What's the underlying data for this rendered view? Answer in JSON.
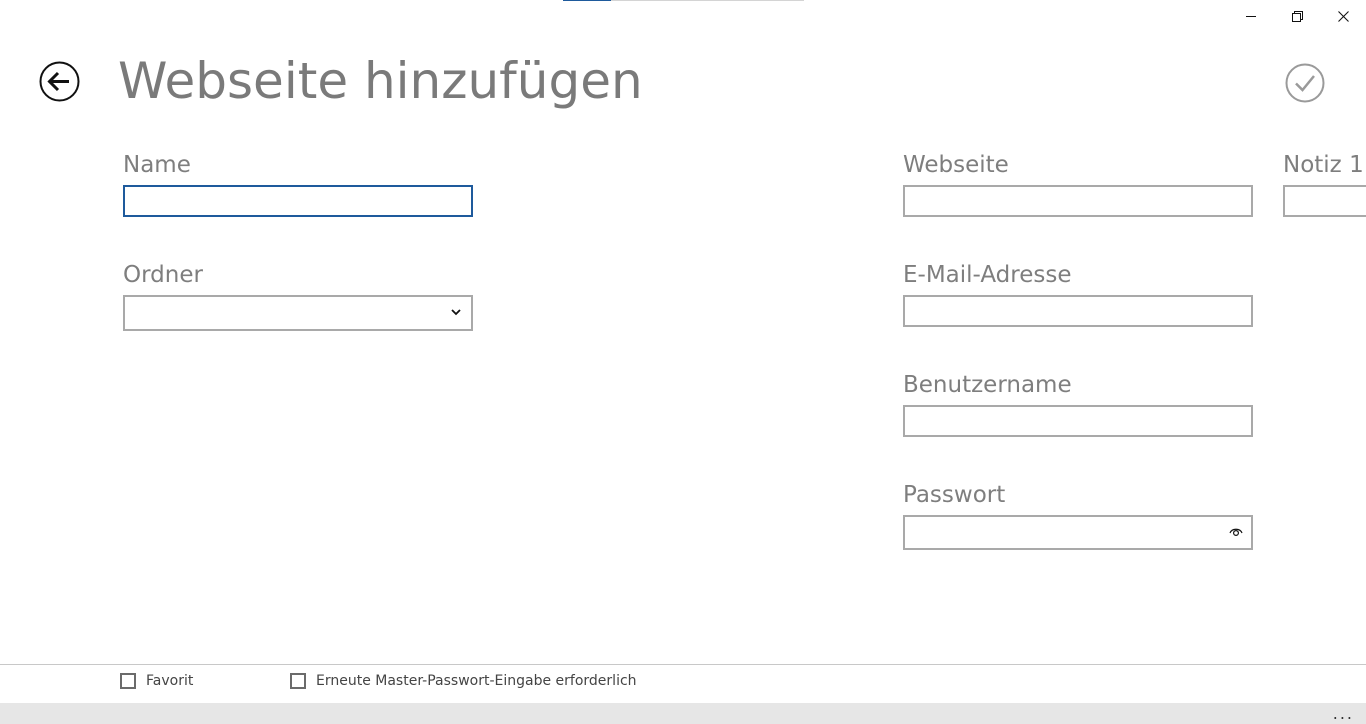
{
  "progress": {
    "fraction": 0.2,
    "color": "#1e5a9c"
  },
  "window_controls": {
    "minimize_icon": "minimize-icon",
    "restore_icon": "restore-icon",
    "close_icon": "close-icon"
  },
  "header": {
    "title": "Webseite hinzufügen",
    "back_icon": "arrow-left-circle-icon",
    "save_icon": "check-circle-icon"
  },
  "form": {
    "name": {
      "label": "Name",
      "value": "",
      "focused": true
    },
    "folder": {
      "label": "Ordner",
      "value": ""
    },
    "website": {
      "label": "Webseite",
      "value": ""
    },
    "email": {
      "label": "E-Mail-Adresse",
      "value": ""
    },
    "username": {
      "label": "Benutzername",
      "value": ""
    },
    "password": {
      "label": "Passwort",
      "value": "",
      "reveal_icon": "eye-icon"
    },
    "note": {
      "label": "Notiz 1",
      "value": ""
    }
  },
  "options": {
    "favorite": {
      "label": "Favorit",
      "checked": false
    },
    "reprompt": {
      "label": "Erneute Master-Passwort-Eingabe erforderlich",
      "checked": false
    }
  },
  "app_bar": {
    "more_label": "..."
  },
  "colors": {
    "accent": "#1e5a9c",
    "title_gray": "#7a7a7a",
    "border_gray": "#a9a9a9",
    "app_bar_bg": "#e6e6e6"
  }
}
